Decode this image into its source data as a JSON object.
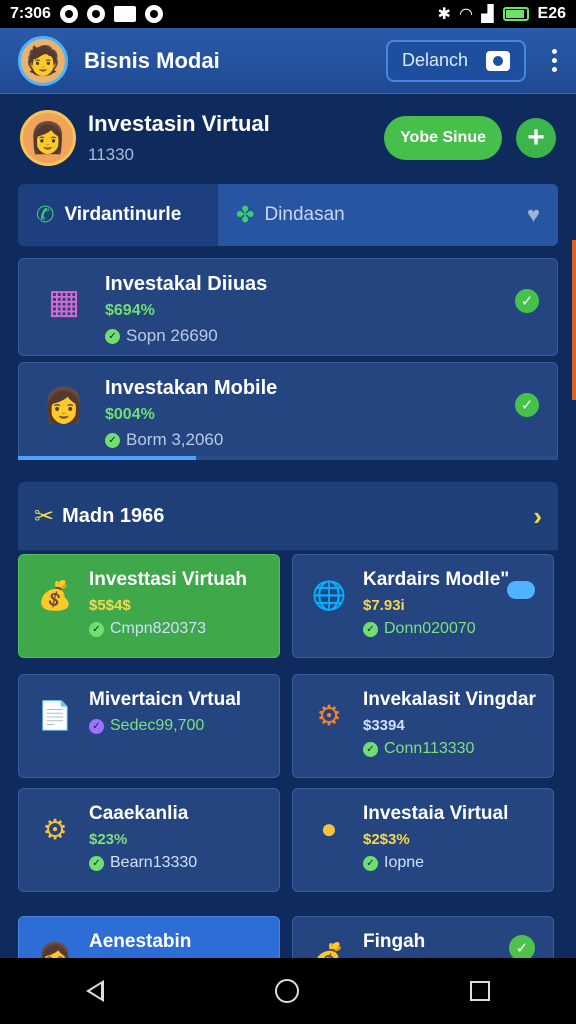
{
  "status": {
    "time": "7:306",
    "battery": "E26"
  },
  "appbar": {
    "title": "Bisnis Modai",
    "button_label": "Delanch"
  },
  "profile": {
    "name": "Investasin Virtual",
    "sub": "11330",
    "primary_button": "Yobe Sinue",
    "plus": "+"
  },
  "tabs": {
    "active": "Virdantinurle",
    "inactive": "Dindasan"
  },
  "featured": [
    {
      "title": "Investakal Diiuas",
      "price": "$694%",
      "stat": "Sopn 26690",
      "icon": "gift-box"
    },
    {
      "title": "Investakan Mobile",
      "price": "$004%",
      "stat": "Borm 3,2060",
      "icon": "avatar"
    }
  ],
  "progress": 0.33,
  "section": {
    "title": "Madn 1966"
  },
  "grid": [
    {
      "title": "Investtasi Virtuah",
      "price": "$5$4$",
      "stat": "Cmpn820373",
      "icon": "dollar-bag"
    },
    {
      "title": "Kardairs Modle\"",
      "price": "$7.93i",
      "stat": "Donn020070",
      "icon": "globe"
    },
    {
      "title": "Mivertaicn Vrtual",
      "price": "",
      "stat": "Sedec99,700",
      "icon": "document"
    },
    {
      "title": "Invekalasit Vingdar",
      "price": "$3394",
      "stat": "Conn113330",
      "icon": "gear"
    },
    {
      "title": "Caaekanlia",
      "price": "$23%",
      "stat": "Bearn13330",
      "icon": "gear-wrench"
    },
    {
      "title": "Investaia Virtual",
      "price": "$2$3%",
      "stat": "Iopne",
      "icon": "coin"
    },
    {
      "title": "Aenestabin",
      "price": "",
      "stat": "",
      "icon": "avatar"
    },
    {
      "title": "Fingah",
      "price": "",
      "stat": "",
      "icon": "money-bag"
    }
  ]
}
